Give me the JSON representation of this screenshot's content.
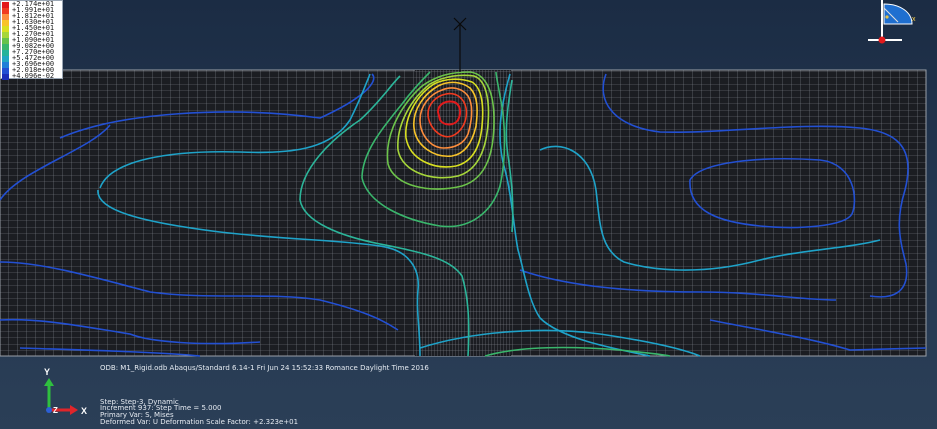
{
  "legend": {
    "entries": [
      {
        "label": "+2.174e+01",
        "color": "#e31a1c"
      },
      {
        "label": "+1.991e+01",
        "color": "#f03b20"
      },
      {
        "label": "+1.812e+01",
        "color": "#fd8d3c"
      },
      {
        "label": "+1.630e+01",
        "color": "#f8c32a"
      },
      {
        "label": "+1.450e+01",
        "color": "#d9e021"
      },
      {
        "label": "+1.270e+01",
        "color": "#a6d63a"
      },
      {
        "label": "+1.090e+01",
        "color": "#66c24a"
      },
      {
        "label": "+9.082e+00",
        "color": "#3ab66c"
      },
      {
        "label": "+7.270e+00",
        "color": "#26b39a"
      },
      {
        "label": "+5.472e+00",
        "color": "#22a7c3"
      },
      {
        "label": "+3.696e+00",
        "color": "#1f7fd8"
      },
      {
        "label": "+2.018e+00",
        "color": "#2350d3"
      },
      {
        "label": "+4.096e-02",
        "color": "#1b2fb8"
      }
    ]
  },
  "info": {
    "odb": "ODB: M1_Rigid.odb    Abaqus/Standard 6.14-1    Fri Jun 24 15:52:33 Romance Daylight Time 2016",
    "step": "Step: Step-3, Dynamic",
    "increment": "Increment    937: Step Time =    5.000",
    "primary_var": "Primary Var: S, Mises",
    "deformed_var": "Deformed Var: U   Deformation Scale Factor: +2.323e+01"
  },
  "triad": {
    "y_label": "Y",
    "z_label": "Z",
    "x_label": "X"
  },
  "view_cube": {
    "x_label": "x"
  },
  "colors": {
    "mesh_bg": "#1b1d22",
    "mesh_line": "#8a8f98",
    "background": "#22354e"
  }
}
